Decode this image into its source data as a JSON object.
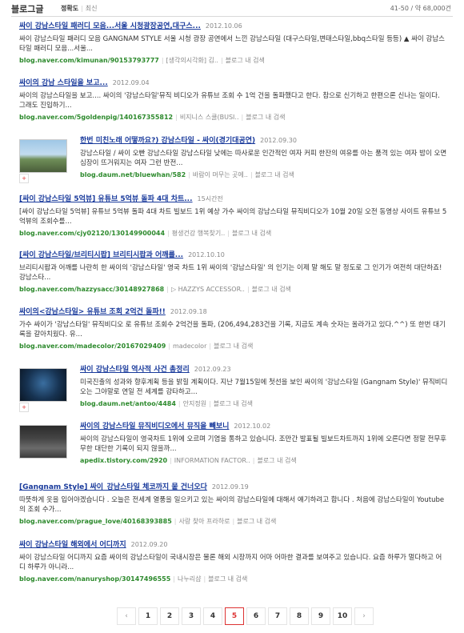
{
  "header": {
    "title": "블로그글",
    "sort_active": "정확도",
    "sort_inactive": "최신",
    "count": "41-50 / 약 68,000건"
  },
  "items": [
    {
      "title": "싸이 강남스타일 패러디 모음...서울 시청광장공연,대구스...",
      "date": "2012.10.06",
      "desc": "싸이 강남스타일 패러디 모음 GANGNAM STYLE 서울 시청 광장 공연에서 느낀 강남스타일 (대구스타일,변태스타일,bbq스타일 등등) ▲ 싸이 강남스타일 패러디 모음...서울...",
      "url": "blog.naver.com/kimunan/90153793777",
      "source": "[생각의시각화] 김..",
      "search": "블로그 내 검색"
    },
    {
      "title": "싸이의 강남 스타일을 보고...",
      "date": "2012.09.04",
      "desc": "싸이의 강남스타일을 보고.... 싸이의 '강남스타일'뮤직 비디오가 유튜브 조회 수 1억 건을 돌파했다고 한다. 참으로 신기하고 한편으론 신나는 일이다. 그래도 진입하기...",
      "url": "blog.naver.com/5goldenpig/140167355812",
      "source": "비지니스 스쿨(BUSI..",
      "search": "블로그 내 검색"
    },
    {
      "title": "한번 미친노래 어떻까요?) 강남스타일 - 싸이(경기대공연)",
      "date": "2012.09.30",
      "desc": "강남스타일 / 싸이 오빤 강남스타일 강남스타일 낮에는 따사로운 인간적인 여자 커피 한잔의 여유를 아는 품격 있는 여자 밤이 오면 심장이 뜨거워지는 여자 그런 반전...",
      "url": "blog.daum.net/bluewhan/582",
      "source": "바람이 머무는 곳에..",
      "search": "블로그 내 검색"
    },
    {
      "title": "[싸이 강남스타일 5억뷰] 유튜브 5억뷰 돌파 4대 차트...",
      "date": "15시간전",
      "desc": "[싸이 강남스타일 5억뷰] 유튜브 5억뷰 돌파 4대 차트 빌보드 1위 예상 가수 싸이의 강남스타일 뮤직비디오가 10월 20일 오전 동영상 사이트 유튜브 5억뷰의 조회수를...",
      "url": "blog.naver.com/cjy02120/130149900044",
      "source": "평생건강 행복찾기..",
      "search": "블로그 내 검색"
    },
    {
      "title": "[싸이 강남스타일/브리티시팝] 브리티시팝과 어깨를...",
      "date": "2012.10.10",
      "desc": "브리티시팝과 어깨를 나란히 한 싸이의 '강남스타일' 영국 차트 1위 싸이의 '강남스타일' 의 인기는 이제 말 해도 말 정도로 그 인기가 여전히 대단하죠! 강남스타...",
      "url": "blog.naver.com/hazzysacc/30148927868",
      "source": "▷ HAZZYS ACCESSOR..",
      "search": "블로그 내 검색"
    },
    {
      "title": "싸이의<강남스타일> 유튜브 조회 2억건 돌파!!",
      "date": "2012.09.18",
      "desc": "가수 싸이가 '강남스타일' 뮤직비디오 로 유튜브 조회수 2억건을 돌파, (206,494,283건을 기록, 지금도 계속 숫자는 올라가고 있다.^^) 또 한번 대기록을 갈아치웠다. 유...",
      "url": "blog.naver.com/madecolor/20167029409",
      "source": "madecolor",
      "search": "블로그 내 검색"
    },
    {
      "title": "싸이 강남스타일 역사적 사건 총정리",
      "date": "2012.09.23",
      "desc": "미국진출의 성과와 향후계획 등을 밝힐 계획이다. 지난 7월15일에 첫선을 보인 싸이의 '강남스타일 (Gangnam Style)' 뮤직비디오는 그야말로 연일 전 세계를 강타하고...",
      "url": "blog.daum.net/antoo/4484",
      "source": "안지정원",
      "search": "블로그 내 검색"
    },
    {
      "title": "싸이의 강남스타일 뮤직비디오에서 뮤직을 빼보니",
      "date": "2012.10.02",
      "desc": "싸이의 강남스타일이 영국차트 1위에 오르며 기염을 통하고 있습니다. 조만간 발표될 빌보드차트까지 1위에 오른다면 정말 전무후무한 대단한 기록이 되지 않을까...",
      "url": "apedix.tistory.com/2920",
      "source": "INFORMATION FACTOR..",
      "search": "블로그 내 검색"
    },
    {
      "title": "[Gangnam Style] 싸이_강남스타일 체코까지 뭍 건너오다",
      "date": "2012.09.19",
      "desc": "따뜻하게 옷을 입어야겠습니다 . 오늘은 전세계 열풍을 일으키고 있는 싸이의 강남스타일에 대해서 얘기하려고 합니다 . 처음에 강남스타일이 Youtube 의 조회 수가...",
      "url": "blog.naver.com/prague_love/40168393885",
      "source": "사랑 찾아 프라하로",
      "search": "블로그 내 검색"
    },
    {
      "title": "싸이 강남스타일 해외에서 어디까지",
      "date": "2012.09.20",
      "desc": "싸이 강남스타일 어디까지 요즘 싸이의 강남스타일이 국내시장은 물론 해외 시장까지 어마 어마한 결과를 보여주고 있습니다. 요즘 하루가 멀다하고 어디 하루가 아니라...",
      "url": "blog.naver.com/nanuryshop/30147496555",
      "source": "나누리샵",
      "search": "블로그 내 검색"
    }
  ],
  "pager": {
    "prev": "‹",
    "pages": [
      "1",
      "2",
      "3",
      "4",
      "5",
      "6",
      "7",
      "8",
      "9",
      "10"
    ],
    "current": "5",
    "next": "›"
  }
}
